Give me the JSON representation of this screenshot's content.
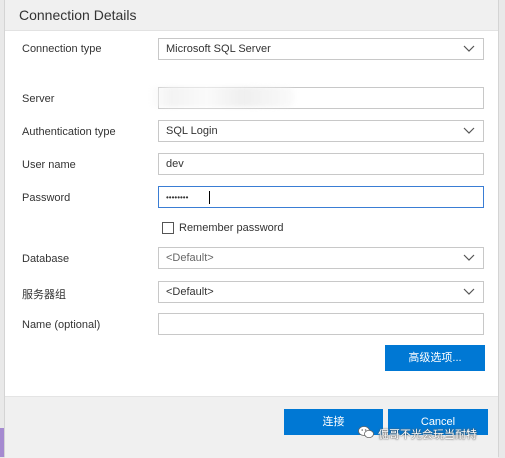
{
  "dialog": {
    "title": "Connection Details"
  },
  "form": {
    "connection_type": {
      "label": "Connection type",
      "value": "Microsoft SQL Server"
    },
    "server": {
      "label": "Server",
      "value": ""
    },
    "authentication_type": {
      "label": "Authentication type",
      "value": "SQL Login"
    },
    "user_name": {
      "label": "User name",
      "value": "dev"
    },
    "password": {
      "label": "Password",
      "value": "••••••••"
    },
    "remember_password": {
      "label": "Remember password",
      "checked": false
    },
    "database": {
      "label": "Database",
      "value": "<Default>"
    },
    "server_group": {
      "label": "服务器组",
      "value": "<Default>"
    },
    "name": {
      "label": "Name (optional)",
      "value": ""
    }
  },
  "buttons": {
    "advanced": "高级选项...",
    "connect": "连接",
    "cancel": "Cancel"
  },
  "watermark": {
    "text": "倔哥不光会玩当耐特",
    "icon": "wechat-icon"
  },
  "colors": {
    "accent": "#0078d4",
    "focus_border": "#3a7dd4"
  }
}
